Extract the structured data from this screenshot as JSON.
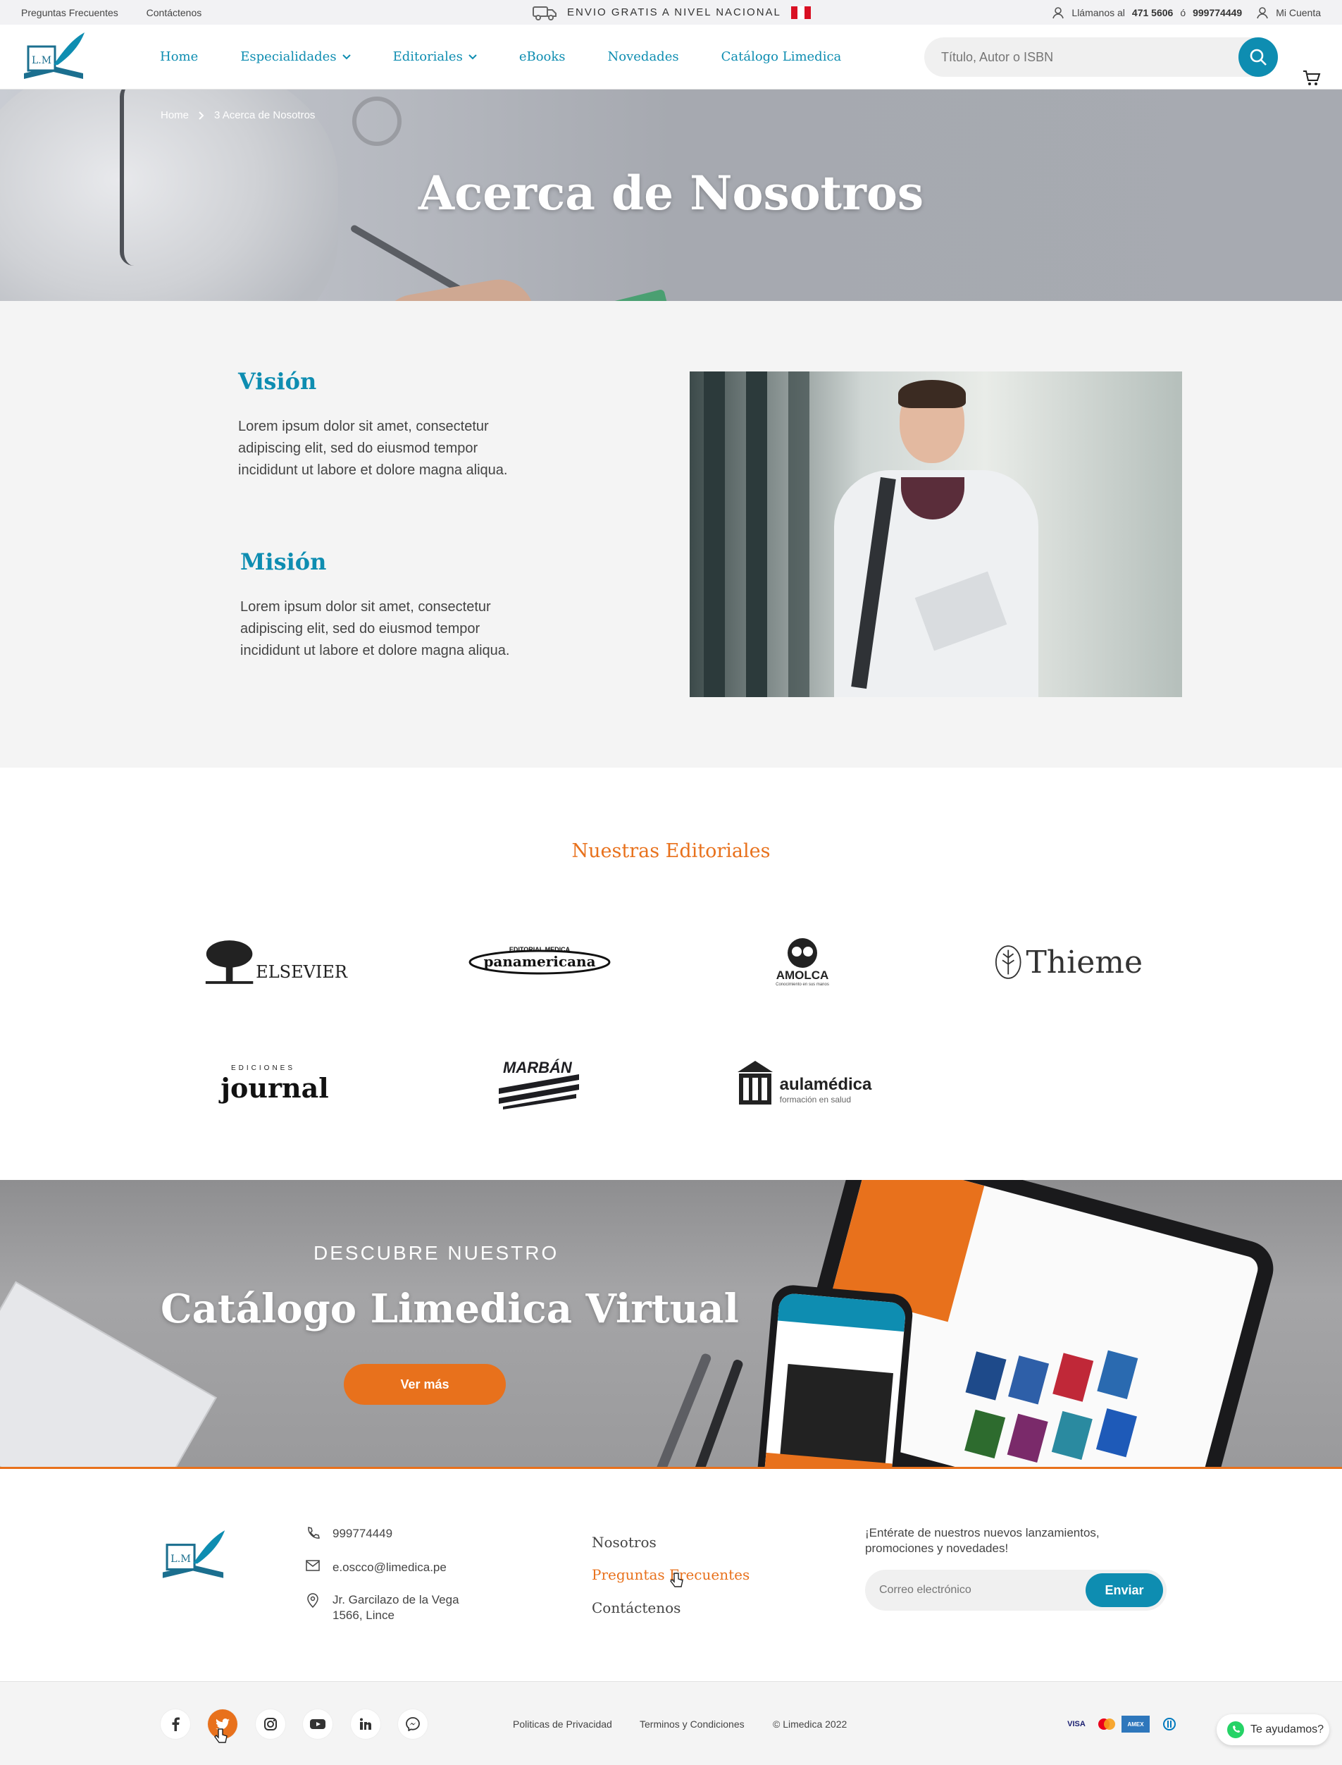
{
  "topbar": {
    "faq": "Preguntas Frecuentes",
    "contact": "Contáctenos",
    "shipping": "ENVIO GRATIS A NIVEL NACIONAL",
    "call_label": "Llámanos al",
    "phone1": "471 5606",
    "or": "ó",
    "phone2": "999774449",
    "account": "Mi Cuenta"
  },
  "header": {
    "nav": [
      "Home",
      "Especialidades",
      "Editoriales",
      "eBooks",
      "Novedades",
      "Catálogo Limedica"
    ],
    "search_placeholder": "Título, Autor o ISBN"
  },
  "hero": {
    "breadcrumb_home": "Home",
    "breadcrumb_current": "3 Acerca de Nosotros",
    "title": "Acerca de Nosotros"
  },
  "about": {
    "vision_title": "Visión",
    "vision_text": "Lorem ipsum dolor sit amet, consectetur adipiscing elit, sed do eiusmod tempor incididunt ut labore et dolore magna aliqua.",
    "mission_title": "Misión",
    "mission_text": "Lorem ipsum dolor sit amet, consectetur adipiscing elit, sed do eiusmod tempor incididunt ut labore et dolore magna aliqua."
  },
  "editoriales": {
    "title": "Nuestras Editoriales",
    "logos": [
      "ELSEVIER",
      "panamericana",
      "AMOLCA",
      "Thieme",
      "journal",
      "MARBÁN",
      "aulamédica"
    ],
    "panamericana_top": "EDITORIAL MEDICA",
    "amolca_tagline": "Conocimiento en sus manos",
    "journal_top": "EDICIONES",
    "aula_tagline": "formación en salud"
  },
  "banner": {
    "subtitle": "DESCUBRE NUESTRO",
    "title": "Catálogo Limedica Virtual",
    "button": "Ver más"
  },
  "footer": {
    "phone": "999774449",
    "email": "e.oscco@limedica.pe",
    "address_line1": "Jr. Garcilazo de la Vega",
    "address_line2": "1566, Lince",
    "links": [
      "Nosotros",
      "Preguntas Frecuentes",
      "Contáctenos"
    ],
    "newsletter_text": "¡Entérate de nuestros nuevos lanzamientos, promociones y novedades!",
    "email_placeholder": "Correo electrónico",
    "send": "Enviar"
  },
  "bottom": {
    "privacy": "Politicas de Privacidad",
    "terms": "Terminos y Condiciones",
    "copyright": "© Limedica 2022",
    "payments": [
      "VISA",
      "Mastercard",
      "AMEX",
      "Diners"
    ],
    "social": [
      "facebook-icon",
      "twitter-icon",
      "instagram-icon",
      "youtube-icon",
      "linkedin-icon",
      "messenger-icon"
    ]
  },
  "help": {
    "label": "Te ayudamos?"
  },
  "colors": {
    "primary": "#0e8db1",
    "accent": "#e8711c",
    "flag_red": "#d91023"
  }
}
